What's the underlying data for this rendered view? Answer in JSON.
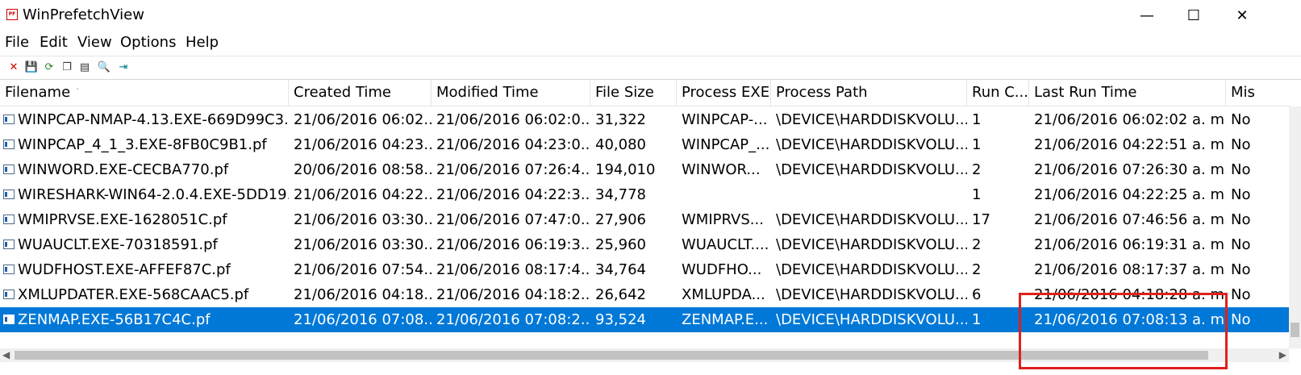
{
  "window": {
    "title": "WinPrefetchView",
    "app_icon_text": "PF",
    "minimize_glyph": "—",
    "maximize_glyph": "☐",
    "close_glyph": "✕"
  },
  "menu": [
    "File",
    "Edit",
    "View",
    "Options",
    "Help"
  ],
  "toolbar": [
    {
      "name": "delete-icon",
      "glyph": "✕",
      "color": "#d00000"
    },
    {
      "name": "save-icon",
      "glyph": "💾",
      "color": "#000000"
    },
    {
      "name": "refresh-icon",
      "glyph": "⟳",
      "color": "#2a8a2a"
    },
    {
      "name": "copy-icon",
      "glyph": "❐",
      "color": "#333333"
    },
    {
      "name": "properties-icon",
      "glyph": "▤",
      "color": "#333333"
    },
    {
      "name": "find-icon",
      "glyph": "🔍",
      "color": "#333333"
    },
    {
      "name": "exit-icon",
      "glyph": "⇥",
      "color": "#007a8a"
    }
  ],
  "columns": [
    "Filename",
    "Created Time",
    "Modified Time",
    "File Size",
    "Process EXE",
    "Process Path",
    "Run C...",
    "Last Run Time",
    "Mis"
  ],
  "sort_indicator": "ˊ",
  "rows": [
    [
      "WINPCAP-NMAP-4.13.EXE-669D99C3...",
      "21/06/2016 06:02...",
      "21/06/2016 06:02:0...",
      "31,322",
      "WINPCAP-...",
      "\\DEVICE\\HARDDISKVOLU...",
      "1",
      "21/06/2016 06:02:02 a. m.",
      "No"
    ],
    [
      "WINPCAP_4_1_3.EXE-8FB0C9B1.pf",
      "21/06/2016 04:23...",
      "21/06/2016 04:23:0...",
      "40,080",
      "WINPCAP_...",
      "\\DEVICE\\HARDDISKVOLU...",
      "1",
      "21/06/2016 04:22:51 a. m.",
      "No"
    ],
    [
      "WINWORD.EXE-CECBA770.pf",
      "20/06/2016 08:58...",
      "21/06/2016 07:26:4...",
      "194,010",
      "WINWOR...",
      "\\DEVICE\\HARDDISKVOLU...",
      "2",
      "21/06/2016 07:26:30 a. m...",
      "No"
    ],
    [
      "WIRESHARK-WIN64-2.0.4.EXE-5DD19...",
      "21/06/2016 04:22...",
      "21/06/2016 04:22:3...",
      "34,778",
      "",
      "",
      "1",
      "21/06/2016 04:22:25 a. m.",
      "No"
    ],
    [
      "WMIPRVSE.EXE-1628051C.pf",
      "21/06/2016 03:30...",
      "21/06/2016 07:47:0...",
      "27,906",
      "WMIPRVS...",
      "\\DEVICE\\HARDDISKVOLU...",
      "17",
      "21/06/2016 07:46:56 a. m...",
      "No"
    ],
    [
      "WUAUCLT.EXE-70318591.pf",
      "21/06/2016 03:30...",
      "21/06/2016 06:19:3...",
      "25,960",
      "WUAUCLT....",
      "\\DEVICE\\HARDDISKVOLU...",
      "2",
      "21/06/2016 06:19:31 a. m...",
      "No"
    ],
    [
      "WUDFHOST.EXE-AFFEF87C.pf",
      "21/06/2016 07:54...",
      "21/06/2016 08:17:4...",
      "34,764",
      "WUDFHO...",
      "\\DEVICE\\HARDDISKVOLU...",
      "2",
      "21/06/2016 08:17:37 a. m...",
      "No"
    ],
    [
      "XMLUPDATER.EXE-568CAAC5.pf",
      "21/06/2016 04:18...",
      "21/06/2016 04:18:2...",
      "26,642",
      "XMLUPDA...",
      "\\DEVICE\\HARDDISKVOLU...",
      "6",
      "21/06/2016 04:18:28 a. m.",
      "No"
    ],
    [
      "ZENMAP.EXE-56B17C4C.pf",
      "21/06/2016 07:08...",
      "21/06/2016 07:08:2...",
      "93,524",
      "ZENMAP.E...",
      "\\DEVICE\\HARDDISKVOLU...",
      "1",
      "21/06/2016 07:08:13 a. m.",
      "No"
    ]
  ],
  "selected_row": 8,
  "colors": {
    "selection": "#0078d7",
    "highlight_box": "#e0201b"
  }
}
